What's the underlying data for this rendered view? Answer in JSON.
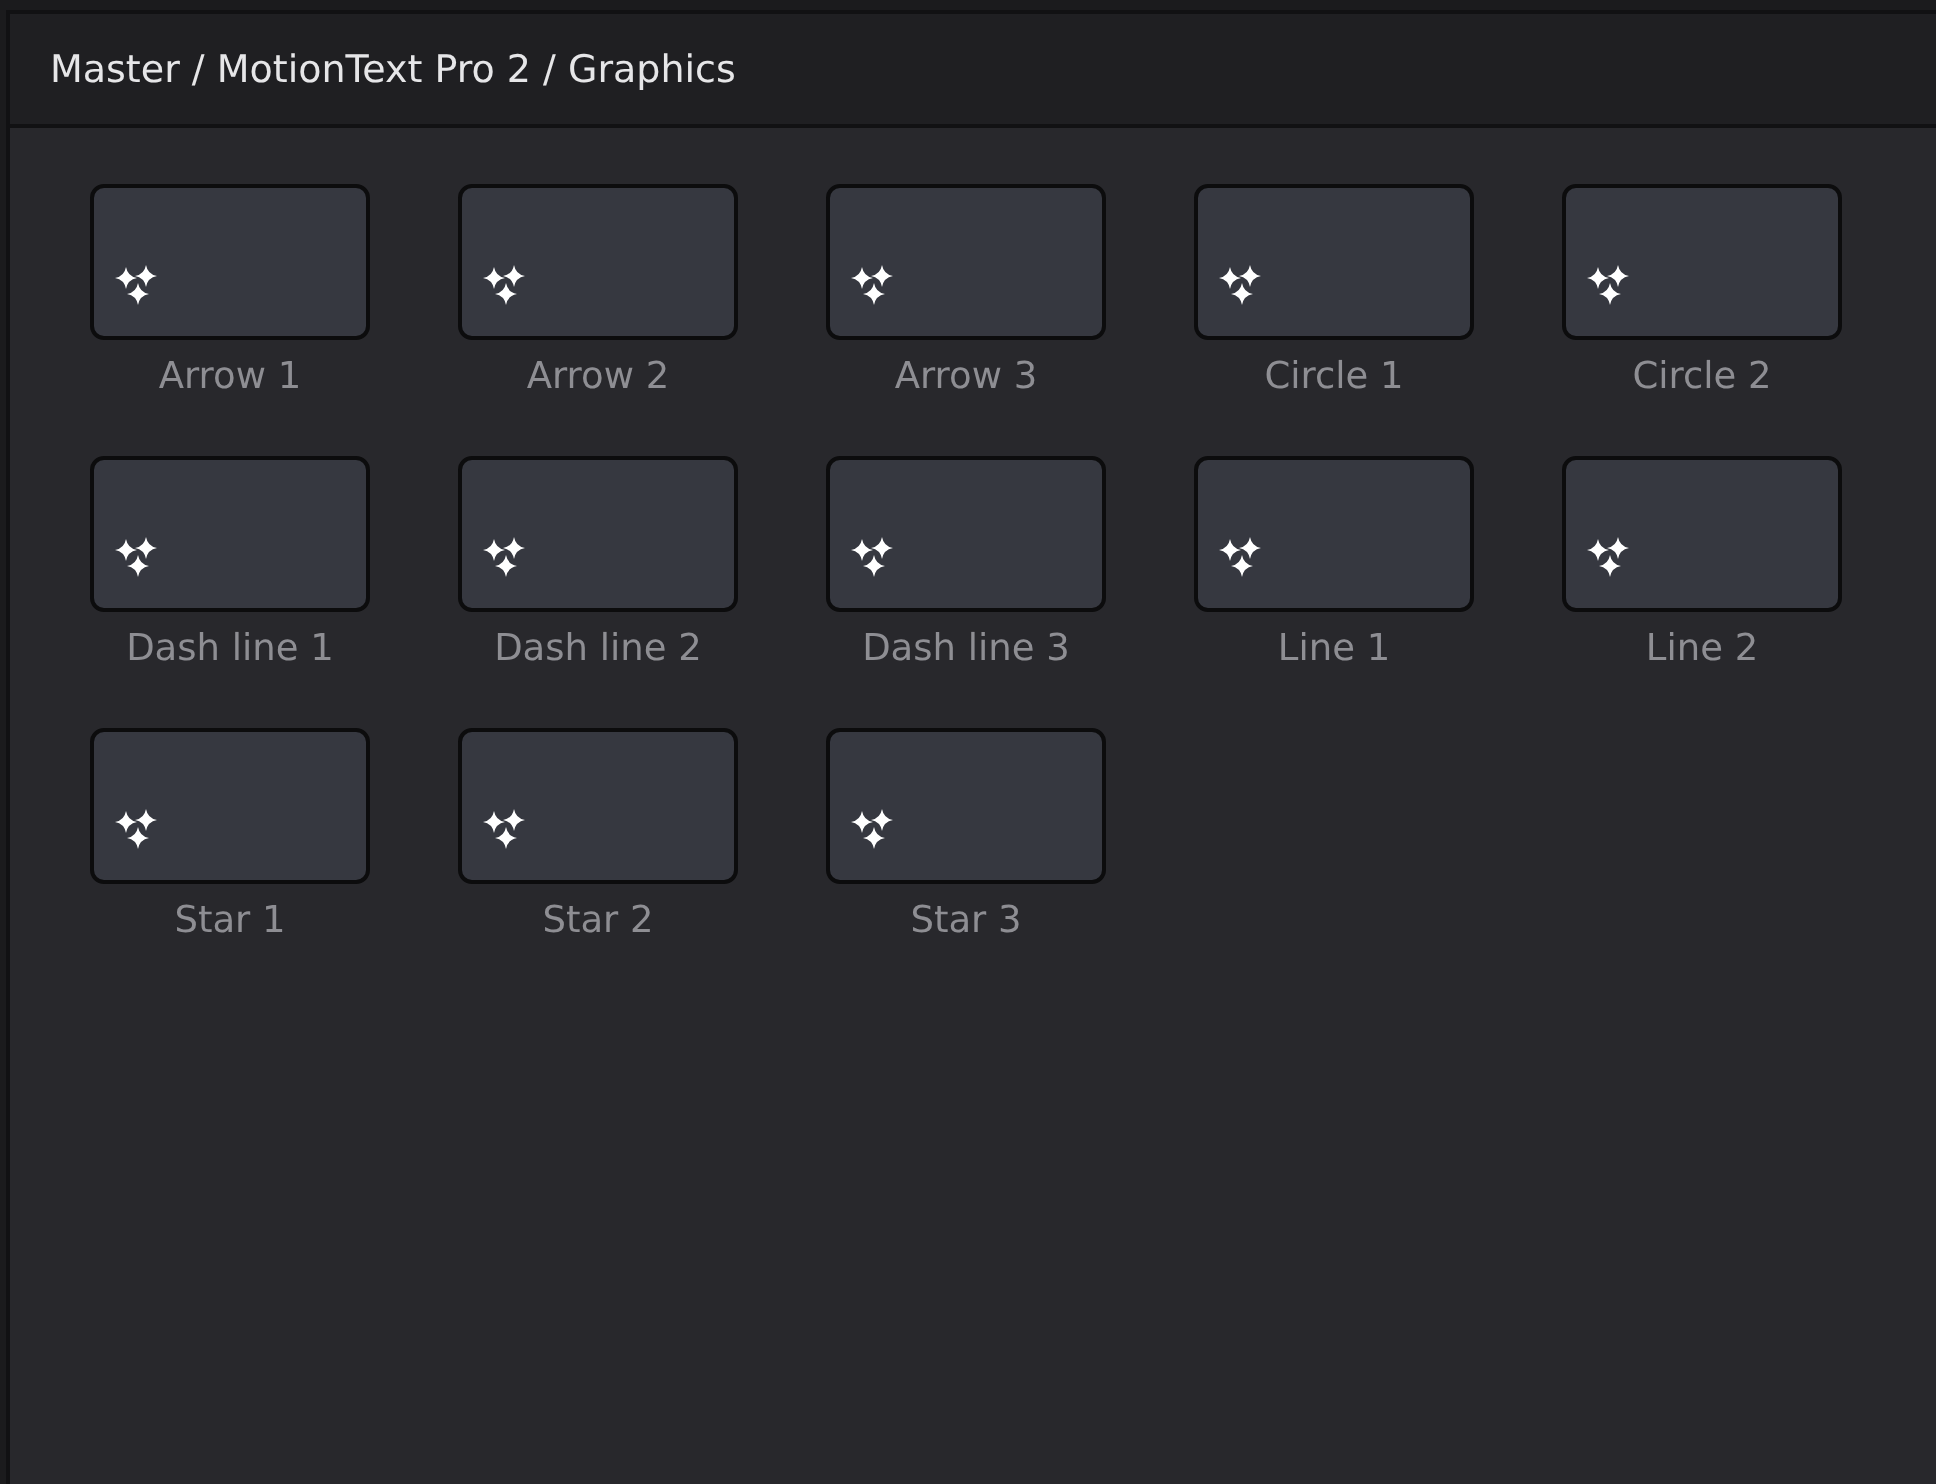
{
  "breadcrumb": "Master / MotionText Pro 2 / Graphics",
  "items": [
    {
      "label": "Arrow 1"
    },
    {
      "label": "Arrow 2"
    },
    {
      "label": "Arrow 3"
    },
    {
      "label": "Circle 1"
    },
    {
      "label": "Circle 2"
    },
    {
      "label": "Dash line 1"
    },
    {
      "label": "Dash line 2"
    },
    {
      "label": "Dash line 3"
    },
    {
      "label": "Line 1"
    },
    {
      "label": "Line 2"
    },
    {
      "label": "Star 1"
    },
    {
      "label": "Star 2"
    },
    {
      "label": "Star 3"
    }
  ]
}
